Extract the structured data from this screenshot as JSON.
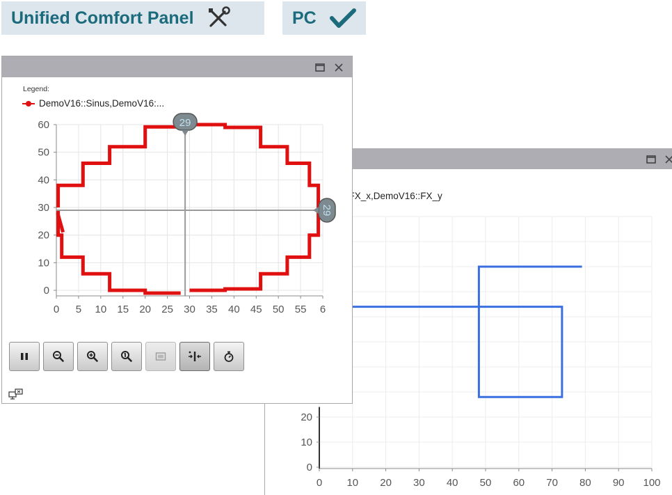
{
  "header": {
    "panel_label": "Unified Comfort Panel",
    "panel_icon": "tools-icon",
    "pc_label": "PC",
    "pc_icon": "checkmark-icon",
    "accent_color": "#1c6b7d",
    "pill_bg": "#dce6ec"
  },
  "trend_window_1": {
    "legend_title": "Legend:",
    "legend_item": "DemoV16::Sinus,DemoV16:...",
    "series_color": "#e01010",
    "cursor_x_label": "29",
    "cursor_y_label": "29",
    "toolbar": [
      {
        "name": "pause-button",
        "icon": "pause-icon",
        "state": "normal"
      },
      {
        "name": "zoom-out-button",
        "icon": "zoom-out-icon",
        "state": "normal"
      },
      {
        "name": "zoom-in-button",
        "icon": "zoom-in-icon",
        "state": "normal"
      },
      {
        "name": "zoom-reset-button",
        "icon": "zoom-100-icon",
        "state": "normal"
      },
      {
        "name": "zoom-area-button",
        "icon": "zoom-area-icon",
        "state": "disabled"
      },
      {
        "name": "ruler-button",
        "icon": "ruler-icon",
        "state": "active"
      },
      {
        "name": "stopwatch-button",
        "icon": "stopwatch-icon",
        "state": "normal"
      }
    ]
  },
  "trend_window_2": {
    "legend_item": "::FX_x,DemoV16::FX_y",
    "series_color": "#3a6fe0"
  },
  "chart_data": [
    {
      "type": "line",
      "title": "",
      "xlabel": "",
      "ylabel": "",
      "xlim": [
        0,
        60
      ],
      "ylim": [
        -1,
        60
      ],
      "x_ticks": [
        "0",
        "5",
        "10",
        "15",
        "20",
        "25",
        "30",
        "35",
        "40",
        "45",
        "50",
        "55",
        "6"
      ],
      "y_ticks": [
        "0",
        "10",
        "20",
        "30",
        "40",
        "50",
        "60"
      ],
      "grid": true,
      "series": [
        {
          "name": "DemoV16::Sinus,DemoV16:...",
          "color": "#e01010",
          "points": [
            [
              0.4,
              30
            ],
            [
              0.4,
              38
            ],
            [
              6,
              38
            ],
            [
              6,
              46
            ],
            [
              12,
              46
            ],
            [
              12,
              52
            ],
            [
              20,
              52
            ],
            [
              20,
              59.2
            ],
            [
              28,
              59.2
            ],
            [
              28,
              60
            ],
            [
              38,
              60
            ],
            [
              38,
              59
            ],
            [
              46,
              59
            ],
            [
              46,
              52
            ],
            [
              52,
              52
            ],
            [
              52,
              46
            ],
            [
              57,
              46
            ],
            [
              57,
              38
            ],
            [
              59,
              38
            ],
            [
              59,
              29.5
            ],
            [
              59,
              28
            ],
            [
              59,
              20
            ],
            [
              57,
              20
            ],
            [
              57,
              12
            ],
            [
              52,
              12
            ],
            [
              52,
              6
            ],
            [
              46,
              6
            ],
            [
              46,
              0.5
            ],
            [
              38,
              0.5
            ],
            [
              38,
              0
            ],
            [
              30,
              0
            ]
          ]
        },
        {
          "name": "",
          "color": "#e01010",
          "points": [
            [
              28,
              -1
            ],
            [
              20,
              -1
            ],
            [
              20,
              0
            ],
            [
              12,
              0
            ],
            [
              12,
              6
            ],
            [
              6,
              6
            ],
            [
              6,
              12
            ],
            [
              1.2,
              12
            ],
            [
              1.2,
              20
            ],
            [
              0.4,
              20
            ],
            [
              0.4,
              29
            ]
          ]
        },
        {
          "name": "",
          "color": "#e01010",
          "points": [
            [
              0.3,
              28
            ],
            [
              1.5,
              21
            ]
          ]
        }
      ],
      "cursor": {
        "x": 29,
        "y": 29
      }
    },
    {
      "type": "line",
      "title": "",
      "xlabel": "",
      "ylabel": "",
      "xlim": [
        0,
        100
      ],
      "ylim": [
        0,
        100
      ],
      "x_ticks": [
        "0",
        "10",
        "20",
        "30",
        "40",
        "50",
        "60",
        "70",
        "80",
        "90",
        "100"
      ],
      "y_ticks_visible": [
        "0",
        "10",
        "20"
      ],
      "grid": true,
      "series": [
        {
          "name": "::FX_x,DemoV16::FX_y",
          "color": "#3a6fe0",
          "points": [
            [
              0,
              64
            ],
            [
              73,
              64
            ],
            [
              73,
              28
            ],
            [
              48,
              28
            ],
            [
              48,
              80
            ],
            [
              79,
              80
            ]
          ]
        }
      ]
    }
  ]
}
